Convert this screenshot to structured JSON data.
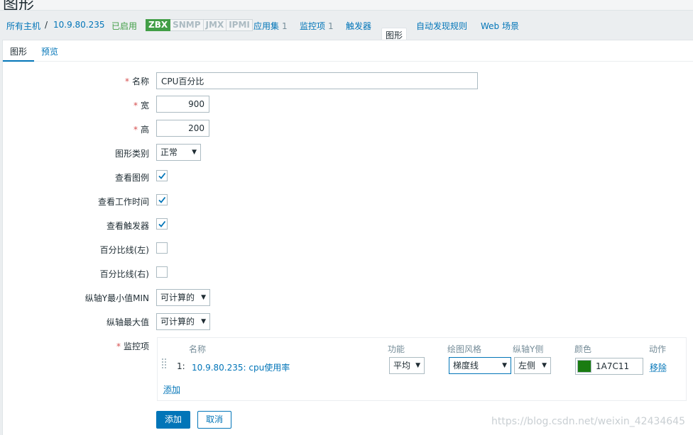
{
  "page": {
    "title": "图形"
  },
  "nav": {
    "all_hosts": "所有主机",
    "separator": "/",
    "host": "10.9.80.235",
    "status": "已启用",
    "badges": [
      "ZBX",
      "SNMP",
      "JMX",
      "IPMI"
    ],
    "applications": {
      "label": "应用集",
      "count": "1"
    },
    "items": {
      "label": "监控项",
      "count": "1"
    },
    "triggers": "触发器",
    "graphs": "图形",
    "discovery": "自动发现规则",
    "web": "Web 场景"
  },
  "tabs": {
    "graph": "图形",
    "preview": "预览"
  },
  "form": {
    "name": {
      "label": "名称",
      "value": "CPU百分比"
    },
    "width": {
      "label": "宽",
      "value": "900"
    },
    "height": {
      "label": "高",
      "value": "200"
    },
    "graph_type": {
      "label": "图形类别",
      "value": "正常"
    },
    "show_legend": {
      "label": "查看图例",
      "checked": true
    },
    "show_working_time": {
      "label": "查看工作时间",
      "checked": true
    },
    "show_triggers": {
      "label": "查看触发器",
      "checked": true
    },
    "percentile_left": {
      "label": "百分比线(左)",
      "checked": false
    },
    "percentile_right": {
      "label": "百分比线(右)",
      "checked": false
    },
    "ymin": {
      "label": "纵轴Y最小值MIN",
      "value": "可计算的"
    },
    "ymax": {
      "label": "纵轴最大值",
      "value": "可计算的"
    },
    "items_label": "监控项"
  },
  "items_table": {
    "headers": {
      "name": "名称",
      "function": "功能",
      "draw_style": "绘图风格",
      "y_axis_side": "纵轴Y侧",
      "color": "颜色",
      "action": "动作"
    },
    "rows": [
      {
        "num": "1:",
        "name": "10.9.80.235: cpu使用率",
        "function": "平均",
        "draw_style": "梯度线",
        "y_axis_side": "左侧",
        "color": "1A7C11",
        "color_hex": "#1A7C11",
        "remove": "移除"
      }
    ],
    "add_link": "添加"
  },
  "buttons": {
    "add": "添加",
    "cancel": "取消"
  },
  "watermark": "https://blog.csdn.net/weixin_42434645",
  "colors": {
    "accent": "#0275b8",
    "enabled": "#429e47",
    "required": "#d64e4e"
  }
}
